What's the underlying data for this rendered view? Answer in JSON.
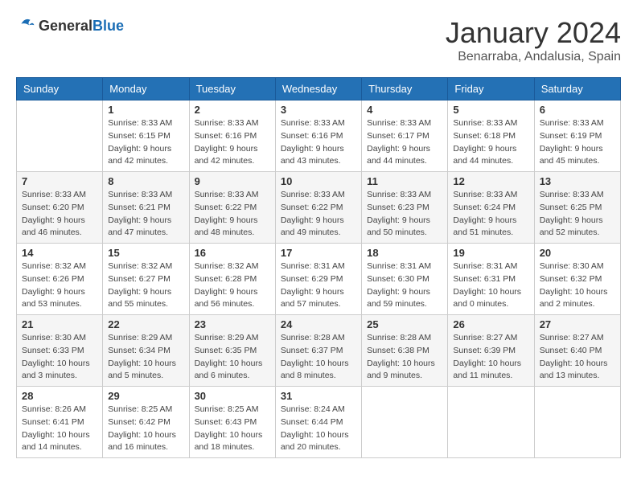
{
  "header": {
    "logo_general": "General",
    "logo_blue": "Blue",
    "month_title": "January 2024",
    "location": "Benarraba, Andalusia, Spain"
  },
  "weekdays": [
    "Sunday",
    "Monday",
    "Tuesday",
    "Wednesday",
    "Thursday",
    "Friday",
    "Saturday"
  ],
  "weeks": [
    [
      {
        "day": "",
        "info": ""
      },
      {
        "day": "1",
        "info": "Sunrise: 8:33 AM\nSunset: 6:15 PM\nDaylight: 9 hours\nand 42 minutes."
      },
      {
        "day": "2",
        "info": "Sunrise: 8:33 AM\nSunset: 6:16 PM\nDaylight: 9 hours\nand 42 minutes."
      },
      {
        "day": "3",
        "info": "Sunrise: 8:33 AM\nSunset: 6:16 PM\nDaylight: 9 hours\nand 43 minutes."
      },
      {
        "day": "4",
        "info": "Sunrise: 8:33 AM\nSunset: 6:17 PM\nDaylight: 9 hours\nand 44 minutes."
      },
      {
        "day": "5",
        "info": "Sunrise: 8:33 AM\nSunset: 6:18 PM\nDaylight: 9 hours\nand 44 minutes."
      },
      {
        "day": "6",
        "info": "Sunrise: 8:33 AM\nSunset: 6:19 PM\nDaylight: 9 hours\nand 45 minutes."
      }
    ],
    [
      {
        "day": "7",
        "info": "Sunrise: 8:33 AM\nSunset: 6:20 PM\nDaylight: 9 hours\nand 46 minutes."
      },
      {
        "day": "8",
        "info": "Sunrise: 8:33 AM\nSunset: 6:21 PM\nDaylight: 9 hours\nand 47 minutes."
      },
      {
        "day": "9",
        "info": "Sunrise: 8:33 AM\nSunset: 6:22 PM\nDaylight: 9 hours\nand 48 minutes."
      },
      {
        "day": "10",
        "info": "Sunrise: 8:33 AM\nSunset: 6:22 PM\nDaylight: 9 hours\nand 49 minutes."
      },
      {
        "day": "11",
        "info": "Sunrise: 8:33 AM\nSunset: 6:23 PM\nDaylight: 9 hours\nand 50 minutes."
      },
      {
        "day": "12",
        "info": "Sunrise: 8:33 AM\nSunset: 6:24 PM\nDaylight: 9 hours\nand 51 minutes."
      },
      {
        "day": "13",
        "info": "Sunrise: 8:33 AM\nSunset: 6:25 PM\nDaylight: 9 hours\nand 52 minutes."
      }
    ],
    [
      {
        "day": "14",
        "info": "Sunrise: 8:32 AM\nSunset: 6:26 PM\nDaylight: 9 hours\nand 53 minutes."
      },
      {
        "day": "15",
        "info": "Sunrise: 8:32 AM\nSunset: 6:27 PM\nDaylight: 9 hours\nand 55 minutes."
      },
      {
        "day": "16",
        "info": "Sunrise: 8:32 AM\nSunset: 6:28 PM\nDaylight: 9 hours\nand 56 minutes."
      },
      {
        "day": "17",
        "info": "Sunrise: 8:31 AM\nSunset: 6:29 PM\nDaylight: 9 hours\nand 57 minutes."
      },
      {
        "day": "18",
        "info": "Sunrise: 8:31 AM\nSunset: 6:30 PM\nDaylight: 9 hours\nand 59 minutes."
      },
      {
        "day": "19",
        "info": "Sunrise: 8:31 AM\nSunset: 6:31 PM\nDaylight: 10 hours\nand 0 minutes."
      },
      {
        "day": "20",
        "info": "Sunrise: 8:30 AM\nSunset: 6:32 PM\nDaylight: 10 hours\nand 2 minutes."
      }
    ],
    [
      {
        "day": "21",
        "info": "Sunrise: 8:30 AM\nSunset: 6:33 PM\nDaylight: 10 hours\nand 3 minutes."
      },
      {
        "day": "22",
        "info": "Sunrise: 8:29 AM\nSunset: 6:34 PM\nDaylight: 10 hours\nand 5 minutes."
      },
      {
        "day": "23",
        "info": "Sunrise: 8:29 AM\nSunset: 6:35 PM\nDaylight: 10 hours\nand 6 minutes."
      },
      {
        "day": "24",
        "info": "Sunrise: 8:28 AM\nSunset: 6:37 PM\nDaylight: 10 hours\nand 8 minutes."
      },
      {
        "day": "25",
        "info": "Sunrise: 8:28 AM\nSunset: 6:38 PM\nDaylight: 10 hours\nand 9 minutes."
      },
      {
        "day": "26",
        "info": "Sunrise: 8:27 AM\nSunset: 6:39 PM\nDaylight: 10 hours\nand 11 minutes."
      },
      {
        "day": "27",
        "info": "Sunrise: 8:27 AM\nSunset: 6:40 PM\nDaylight: 10 hours\nand 13 minutes."
      }
    ],
    [
      {
        "day": "28",
        "info": "Sunrise: 8:26 AM\nSunset: 6:41 PM\nDaylight: 10 hours\nand 14 minutes."
      },
      {
        "day": "29",
        "info": "Sunrise: 8:25 AM\nSunset: 6:42 PM\nDaylight: 10 hours\nand 16 minutes."
      },
      {
        "day": "30",
        "info": "Sunrise: 8:25 AM\nSunset: 6:43 PM\nDaylight: 10 hours\nand 18 minutes."
      },
      {
        "day": "31",
        "info": "Sunrise: 8:24 AM\nSunset: 6:44 PM\nDaylight: 10 hours\nand 20 minutes."
      },
      {
        "day": "",
        "info": ""
      },
      {
        "day": "",
        "info": ""
      },
      {
        "day": "",
        "info": ""
      }
    ]
  ]
}
